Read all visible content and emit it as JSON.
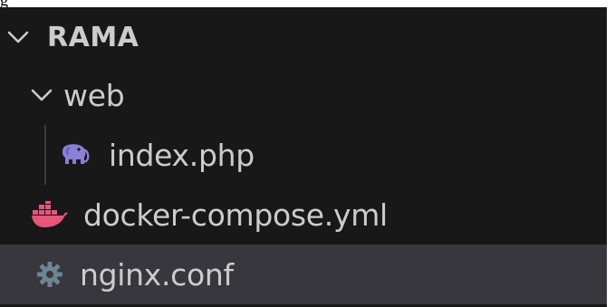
{
  "explorer": {
    "top_fragment": "g",
    "root": {
      "label": "RAMA",
      "expanded": true,
      "icon": "chevron-down-icon"
    },
    "items": [
      {
        "label": "web",
        "type": "folder",
        "expanded": true,
        "icon": "chevron-down-icon",
        "depth": 1
      },
      {
        "label": "index.php",
        "type": "file",
        "icon": "php-elephant-icon",
        "depth": 2
      },
      {
        "label": "docker-compose.yml",
        "type": "file",
        "icon": "docker-whale-icon",
        "depth": 1
      },
      {
        "label": "nginx.conf",
        "type": "file",
        "icon": "gear-icon",
        "depth": 1,
        "selected": true
      }
    ],
    "colors": {
      "background": "#181818",
      "selected_row": "#37373d",
      "text": "#cccccc",
      "php_icon": "#8b7fd6",
      "docker_icon": "#e8557a",
      "gear_icon": "#6d8594"
    }
  }
}
